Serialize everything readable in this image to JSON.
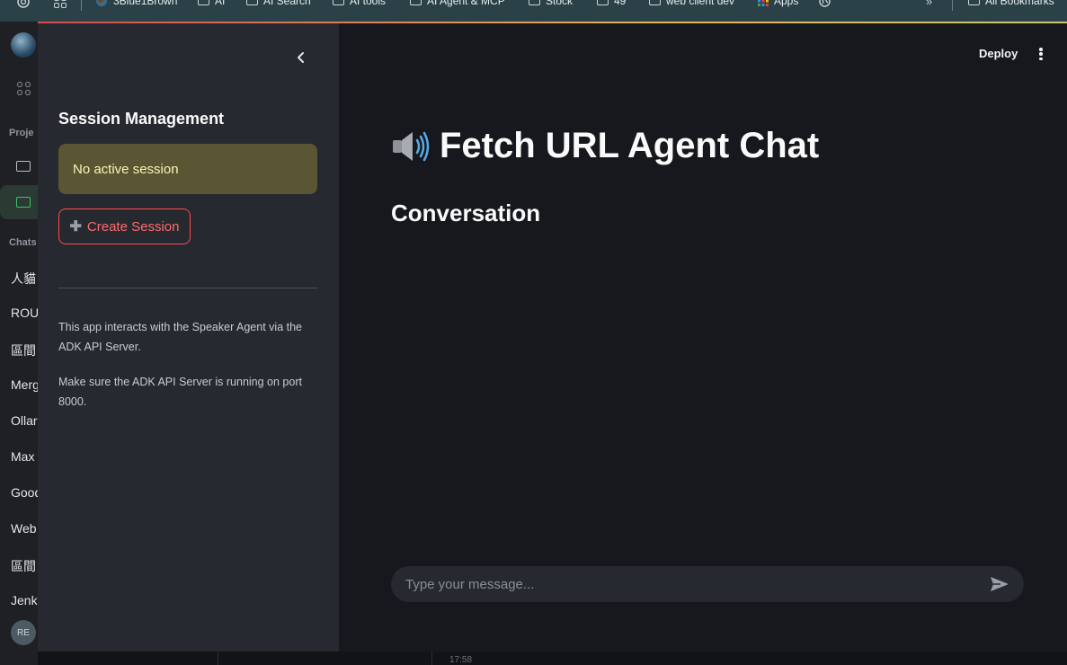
{
  "bookmarks": {
    "items": [
      "3Blue1Brown",
      "AI",
      "AI Search",
      "AI tools",
      "AI Agent & MCP",
      "Stock",
      "49",
      "web client dev",
      "Apps"
    ],
    "all_bookmarks": "All Bookmarks"
  },
  "outer_sidebar": {
    "projects_label": "Proje",
    "chats_label": "Chats",
    "chats": [
      "人貓",
      "ROU",
      "區間",
      "Merg",
      "Ollar",
      "Max",
      "Good",
      "Web",
      "區間",
      "Jenk"
    ],
    "user_initials": "RE"
  },
  "sidebar": {
    "title": "Session Management",
    "status": "No active session",
    "create_button": "Create Session",
    "info_1": "This app interacts with the Speaker Agent via the ADK API Server.",
    "info_2": "Make sure the ADK API Server is running on port 8000."
  },
  "header": {
    "deploy_label": "Deploy"
  },
  "main": {
    "title": "Fetch URL Agent Chat",
    "subtitle": "Conversation",
    "input_placeholder": "Type your message..."
  },
  "footer": {
    "time": "17:58"
  },
  "colors": {
    "accent_red": "#ff4b4b",
    "warning_bg": "#5a5533",
    "main_bg": "#16181d",
    "sidebar_bg": "#262930"
  }
}
